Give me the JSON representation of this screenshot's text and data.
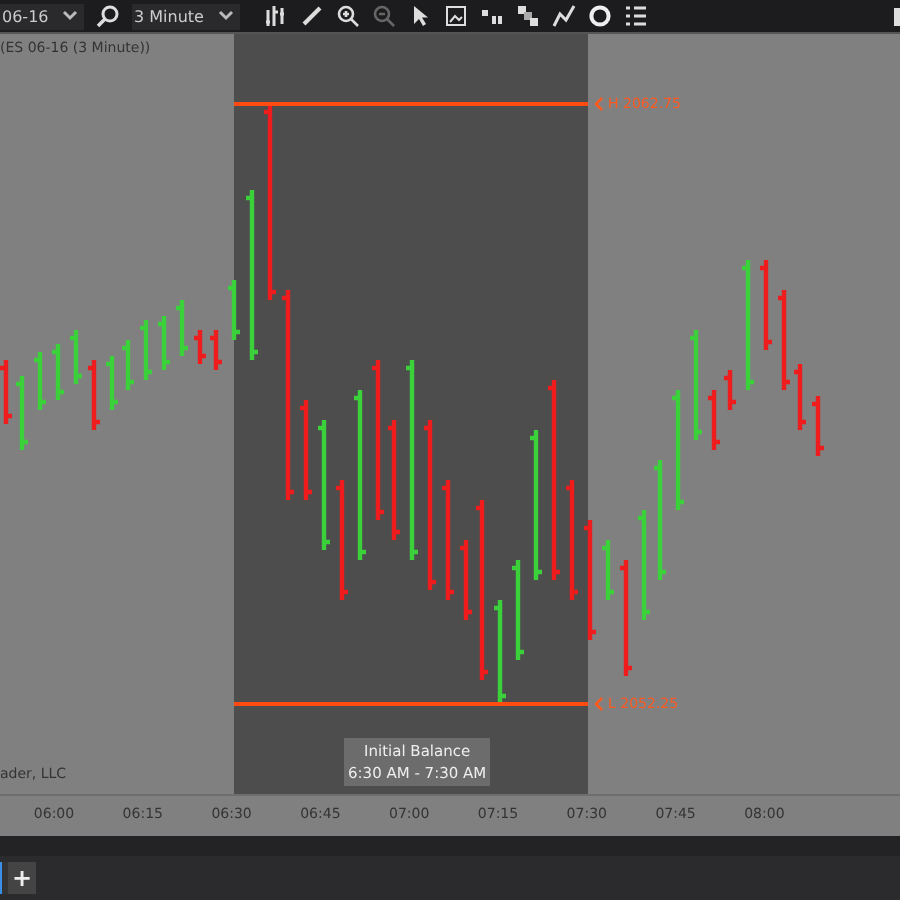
{
  "toolbar": {
    "instrument": "06-16",
    "interval": "3 Minute",
    "zoom_out_disabled": true
  },
  "chart": {
    "title": "(ES 06-16 (3 Minute))",
    "copyright": "ader, LLC",
    "initial_balance": {
      "high_label": "H 2062.75",
      "low_label": "L 2052.25",
      "caption_title": "Initial Balance",
      "caption_range": "6:30 AM - 7:30 AM"
    },
    "time_axis": [
      "06:00",
      "06:15",
      "06:30",
      "06:45",
      "07:00",
      "07:15",
      "07:30",
      "07:45",
      "08:00"
    ]
  },
  "tab_bar": {
    "add_label": "+"
  }
}
